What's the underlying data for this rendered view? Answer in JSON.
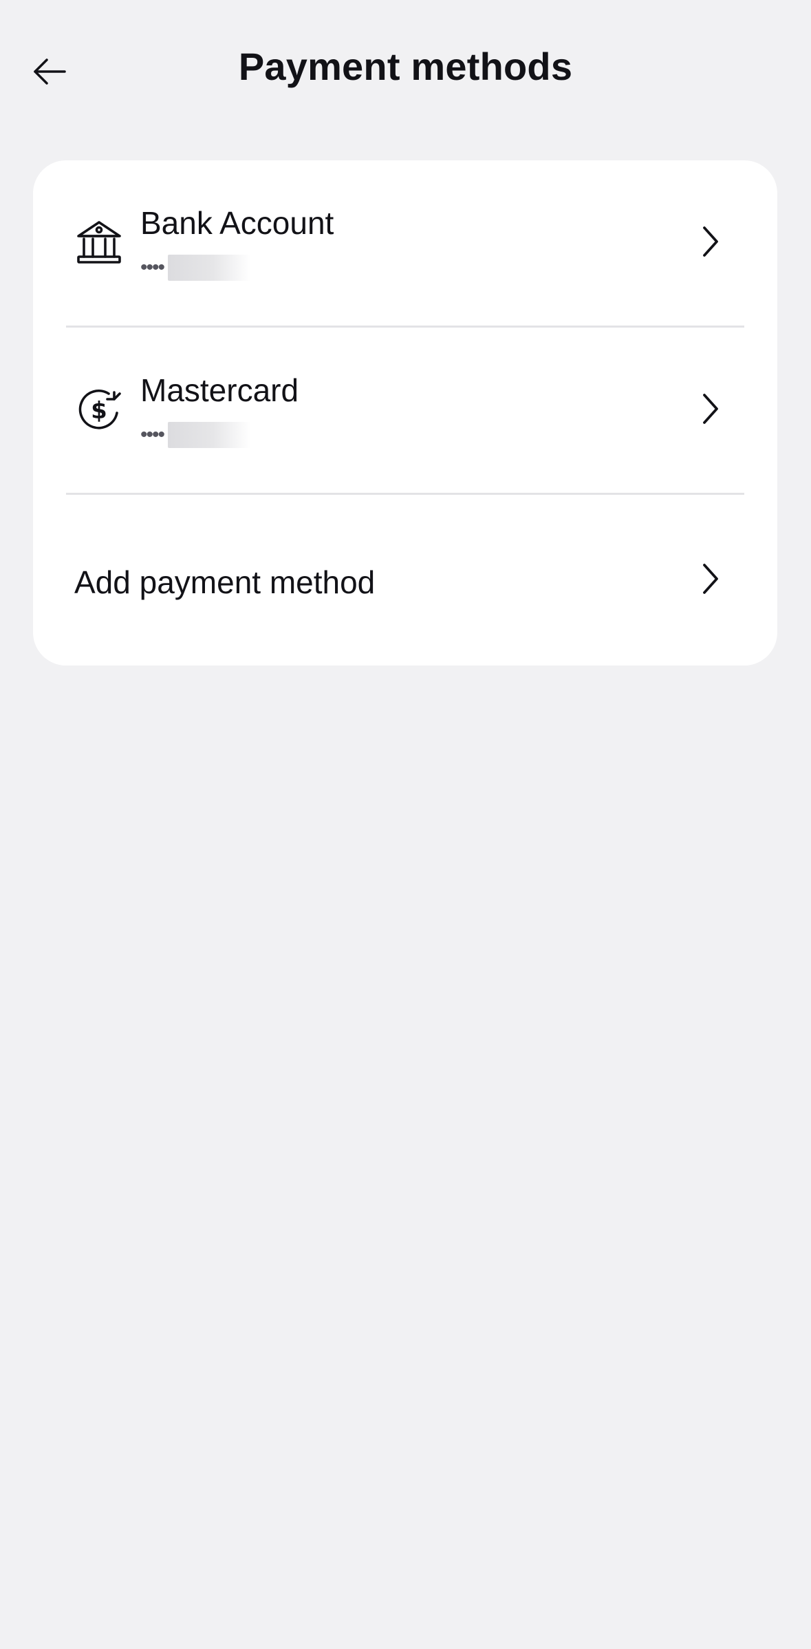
{
  "header": {
    "title": "Payment methods",
    "back_icon": "arrow-left-icon"
  },
  "payment_methods": [
    {
      "icon": "bank-icon",
      "title": "Bank Account",
      "masked": "••••"
    },
    {
      "icon": "dollar-refresh-icon",
      "title": "Mastercard",
      "masked": "••••"
    }
  ],
  "add_method": {
    "label": "Add payment method",
    "icon": "chevron-right-icon"
  },
  "colors": {
    "background": "#f1f1f3",
    "card": "#ffffff",
    "text": "#121217",
    "divider": "#e3e3e6"
  }
}
